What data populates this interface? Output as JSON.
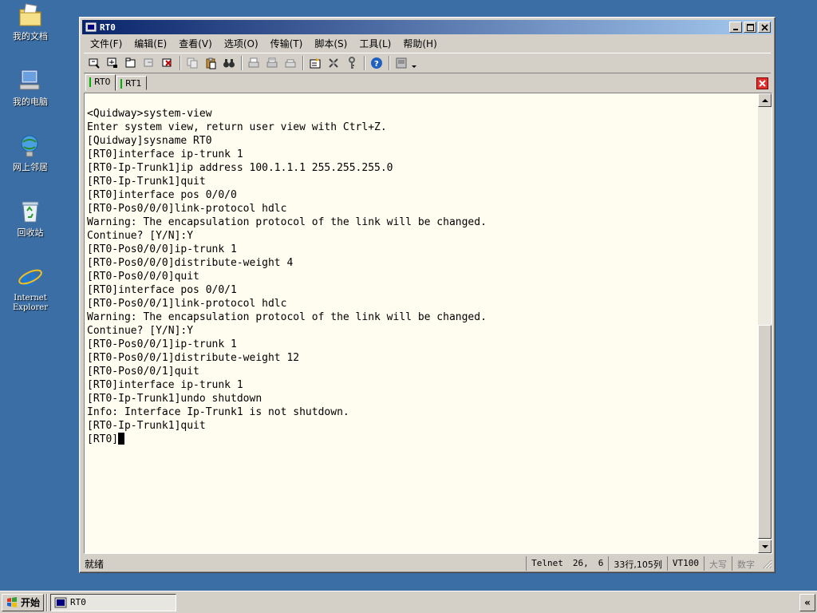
{
  "desktop": {
    "icons": [
      {
        "label": "我的文档",
        "icon": "my-documents-icon"
      },
      {
        "label": "我的电脑",
        "icon": "my-computer-icon"
      },
      {
        "label": "网上邻居",
        "icon": "network-places-icon"
      },
      {
        "label": "回收站",
        "icon": "recycle-bin-icon"
      },
      {
        "label": "Internet Explorer",
        "icon": "internet-explorer-icon"
      }
    ]
  },
  "window": {
    "title": "RT0",
    "menu": [
      "文件(F)",
      "编辑(E)",
      "查看(V)",
      "选项(O)",
      "传输(T)",
      "脚本(S)",
      "工具(L)",
      "帮助(H)"
    ],
    "tabs": [
      "RT0",
      "RT1"
    ],
    "active_tab": "RT0"
  },
  "terminal": {
    "lines": [
      "<Quidway>system-view",
      "Enter system view, return user view with Ctrl+Z.",
      "[Quidway]sysname RT0",
      "[RT0]interface ip-trunk 1",
      "[RT0-Ip-Trunk1]ip address 100.1.1.1 255.255.255.0",
      "[RT0-Ip-Trunk1]quit",
      "[RT0]interface pos 0/0/0",
      "[RT0-Pos0/0/0]link-protocol hdlc",
      "Warning: The encapsulation protocol of the link will be changed.",
      "Continue? [Y/N]:Y",
      "[RT0-Pos0/0/0]ip-trunk 1",
      "[RT0-Pos0/0/0]distribute-weight 4",
      "[RT0-Pos0/0/0]quit",
      "[RT0]interface pos 0/0/1",
      "[RT0-Pos0/0/1]link-protocol hdlc",
      "Warning: The encapsulation protocol of the link will be changed.",
      "Continue? [Y/N]:Y",
      "[RT0-Pos0/0/1]ip-trunk 1",
      "[RT0-Pos0/0/1]distribute-weight 12",
      "[RT0-Pos0/0/1]quit",
      "[RT0]interface ip-trunk 1",
      "[RT0-Ip-Trunk1]undo shutdown",
      "Info: Interface Ip-Trunk1 is not shutdown.",
      "[RT0-Ip-Trunk1]quit"
    ],
    "prompt": "[RT0]"
  },
  "status": {
    "ready": "就绪",
    "protocol": "Telnet",
    "row": "26,",
    "col": "6",
    "size": "33行,105列",
    "emulation": "VT100",
    "caps": "大写",
    "num": "数字"
  },
  "taskbar": {
    "start_label": "开始",
    "task_label": "RT0",
    "tray_label": "«"
  },
  "colors": {
    "desktop": "#3a6ea5",
    "title_start": "#0a246a",
    "title_end": "#a6caf0",
    "terminal_bg": "#fffcf0"
  }
}
